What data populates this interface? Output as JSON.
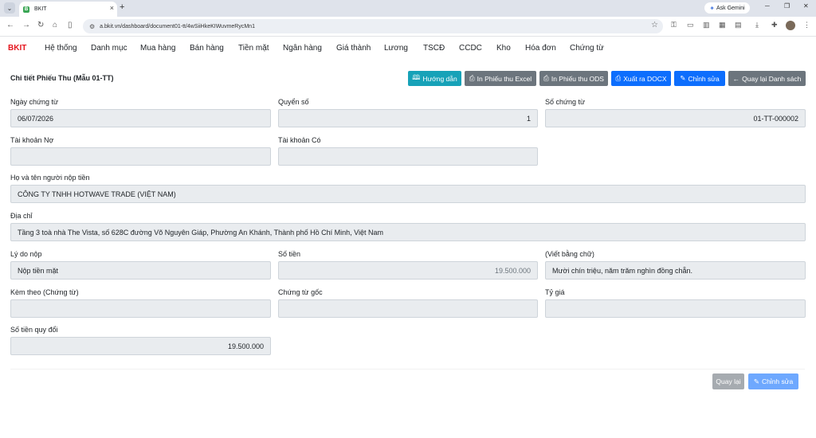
{
  "browser": {
    "tab_title": "BKIT",
    "tab_favicon": "B",
    "gemini_label": "Ask Gemini",
    "url": "a.bkit.vn/dashboard/document01-tt/4wSiiHkeKIWuvmeRycMn1"
  },
  "nav": {
    "brand": "BKIT",
    "items": [
      "Hệ thống",
      "Danh mục",
      "Mua hàng",
      "Bán hàng",
      "Tiền mặt",
      "Ngân hàng",
      "Giá thành",
      "Lương",
      "TSCĐ",
      "CCDC",
      "Kho",
      "Hóa đơn",
      "Chứng từ"
    ]
  },
  "page": {
    "title": "Chi tiết Phiếu Thu (Mẫu 01-TT)"
  },
  "toolbar": {
    "guide": "Hướng dẫn",
    "print_excel": "In Phiếu thu Excel",
    "print_ods": "In Phiếu thu ODS",
    "export_docx": "Xuất ra DOCX",
    "edit": "Chỉnh sửa",
    "back_list": "Quay lại Danh sách"
  },
  "form": {
    "ngay_chung_tu": {
      "label": "Ngày chứng từ",
      "value": "06/07/2026"
    },
    "quyen_so": {
      "label": "Quyển số",
      "value": "1"
    },
    "so_chung_tu": {
      "label": "Số chứng từ",
      "value": "01-TT-000002"
    },
    "tk_no": {
      "label": "Tài khoản Nợ",
      "value": ""
    },
    "tk_co": {
      "label": "Tài khoản Có",
      "value": ""
    },
    "nguoi_nop": {
      "label": "Họ và tên người nộp tiền",
      "value": "CÔNG TY TNHH HOTWAVE TRADE (VIỆT NAM)"
    },
    "dia_chi": {
      "label": "Địa chỉ",
      "value": "Tầng 3 toà nhà The Vista, số 628C đường Võ Nguyên Giáp, Phường An Khánh, Thành phố Hồ Chí Minh, Việt Nam"
    },
    "ly_do": {
      "label": "Lý do nộp",
      "value": "Nộp tiền mặt"
    },
    "so_tien": {
      "label": "Số tiền",
      "value": "19.500.000"
    },
    "bang_chu": {
      "label": "(Viết bằng chữ)",
      "value": "Mười chín triệu, năm trăm nghìn đồng chẵn."
    },
    "kem_theo": {
      "label": "Kèm theo (Chứng từ)",
      "value": ""
    },
    "chung_tu_goc": {
      "label": "Chứng từ gốc",
      "value": ""
    },
    "ty_gia": {
      "label": "Tỷ giá",
      "value": ""
    },
    "quy_doi": {
      "label": "Số tiền quy đổi",
      "value": "19.500.000"
    }
  },
  "footer": {
    "back": "Quay lại",
    "edit": "Chỉnh sửa"
  },
  "colors": {
    "brand": "#e5161e",
    "teal": "#17a2b8",
    "gray": "#6c757d",
    "blue": "#0d6efd"
  }
}
